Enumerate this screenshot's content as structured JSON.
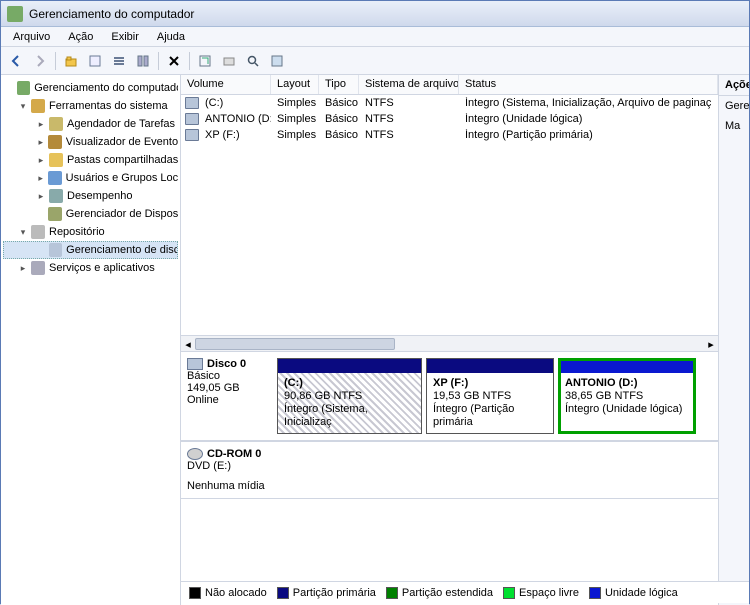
{
  "title": "Gerenciamento do computador",
  "menubar": [
    "Arquivo",
    "Ação",
    "Exibir",
    "Ajuda"
  ],
  "tree": {
    "root": "Gerenciamento do computado",
    "sys_tools": "Ferramentas do sistema",
    "sys_items": [
      "Agendador de Tarefas",
      "Visualizador de Eventos",
      "Pastas compartilhadas",
      "Usuários e Grupos Loca",
      "Desempenho",
      "Gerenciador de Disposit"
    ],
    "storage": "Repositório",
    "disk_mgmt": "Gerenciamento de disco",
    "svc": "Serviços e aplicativos"
  },
  "cols": {
    "volume": "Volume",
    "layout": "Layout",
    "tipo": "Tipo",
    "fs": "Sistema de arquivos",
    "status": "Status"
  },
  "volumes": [
    {
      "name": "(C:)",
      "layout": "Simples",
      "type": "Básico",
      "fs": "NTFS",
      "status": "Íntegro (Sistema, Inicialização, Arquivo de paginaç"
    },
    {
      "name": "ANTONIO (D:)",
      "layout": "Simples",
      "type": "Básico",
      "fs": "NTFS",
      "status": "Íntegro (Unidade lógica)"
    },
    {
      "name": "XP (F:)",
      "layout": "Simples",
      "type": "Básico",
      "fs": "NTFS",
      "status": "Íntegro (Partição primária)"
    }
  ],
  "disk0": {
    "name": "Disco 0",
    "kind": "Básico",
    "size": "149,05 GB",
    "state": "Online",
    "parts": [
      {
        "name": "(C:)",
        "sub": "90,86 GB NTFS",
        "st": "Íntegro (Sistema, Inicializaç"
      },
      {
        "name": "XP  (F:)",
        "sub": "19,53 GB NTFS",
        "st": "Íntegro (Partição primária"
      },
      {
        "name": "ANTONIO  (D:)",
        "sub": "38,65 GB NTFS",
        "st": "Íntegro (Unidade lógica)"
      }
    ]
  },
  "cdrom": {
    "name": "CD-ROM 0",
    "kind": "DVD (E:)",
    "empty": "Nenhuma mídia"
  },
  "legend": {
    "unalloc": "Não alocado",
    "primary": "Partição primária",
    "ext": "Partição estendida",
    "free": "Espaço livre",
    "logical": "Unidade lógica"
  },
  "actions": {
    "header": "Ações",
    "item1": "Gerenci",
    "item2": "Ma"
  }
}
